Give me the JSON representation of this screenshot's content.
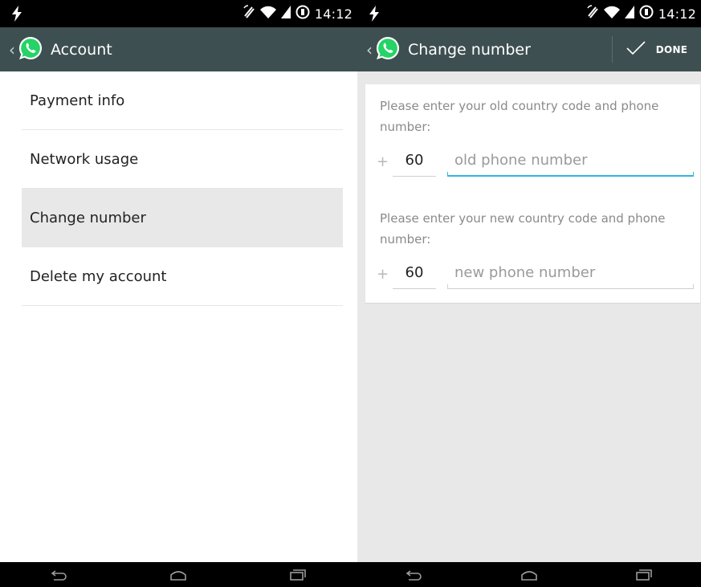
{
  "status_bar": {
    "time": "14:12"
  },
  "left_screen": {
    "action_bar": {
      "title": "Account"
    },
    "list": [
      {
        "label": "Payment info",
        "selected": false
      },
      {
        "label": "Network usage",
        "selected": false
      },
      {
        "label": "Change number",
        "selected": true
      },
      {
        "label": "Delete my account",
        "selected": false
      }
    ]
  },
  "right_screen": {
    "action_bar": {
      "title": "Change number",
      "done_label": "DONE"
    },
    "old_number": {
      "prompt": "Please enter your old country code and phone number:",
      "plus": "+",
      "country_code": "60",
      "placeholder": "old phone number",
      "focused": true
    },
    "new_number": {
      "prompt": "Please enter your new country code and phone number:",
      "plus": "+",
      "country_code": "60",
      "placeholder": "new phone number",
      "focused": false
    }
  },
  "colors": {
    "action_bar": "#3e4f51",
    "whatsapp_green": "#25d366",
    "focus_blue": "#33b5e5",
    "selected_row": "#e8e8e8"
  },
  "icons": {
    "status_left": "lightning-icon",
    "status_right": [
      "rotation-icon",
      "wifi-icon",
      "signal-icon",
      "battery-icon"
    ],
    "nav": [
      "back-icon",
      "home-icon",
      "recents-icon"
    ],
    "action": [
      "back-caret-icon",
      "whatsapp-logo-icon",
      "checkmark-icon"
    ]
  }
}
